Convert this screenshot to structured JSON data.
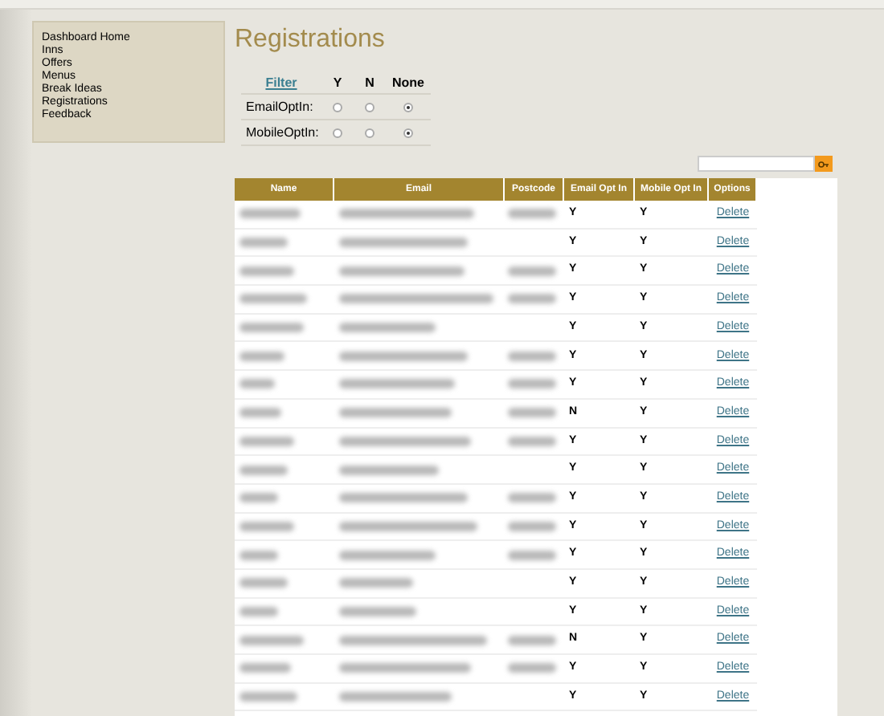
{
  "sidebar": {
    "items": [
      "Dashboard Home",
      "Inns",
      "Offers",
      "Menus",
      "Break Ideas",
      "Registrations",
      "Feedback"
    ]
  },
  "page_title": "Registrations",
  "filter": {
    "heading": "Filter",
    "columns": [
      "Y",
      "N",
      "None"
    ],
    "rows": [
      {
        "label": "EmailOptIn:",
        "options": [
          {
            "selected": false
          },
          {
            "selected": false
          },
          {
            "selected": true
          }
        ]
      },
      {
        "label": "MobileOptIn:",
        "options": [
          {
            "selected": false
          },
          {
            "selected": false
          },
          {
            "selected": true
          }
        ]
      }
    ]
  },
  "table": {
    "columns": [
      "Name",
      "Email",
      "Postcode",
      "Email Opt In",
      "Mobile Opt In",
      "Options"
    ],
    "rows": [
      {
        "postcode_blurred": true,
        "email_opt_in": "Y",
        "mobile_opt_in": "Y",
        "action": "Delete"
      },
      {
        "postcode_blurred": false,
        "email_opt_in": "Y",
        "mobile_opt_in": "Y",
        "action": "Delete"
      },
      {
        "postcode_blurred": true,
        "email_opt_in": "Y",
        "mobile_opt_in": "Y",
        "action": "Delete"
      },
      {
        "postcode_blurred": true,
        "email_opt_in": "Y",
        "mobile_opt_in": "Y",
        "action": "Delete"
      },
      {
        "postcode_blurred": false,
        "email_opt_in": "Y",
        "mobile_opt_in": "Y",
        "action": "Delete"
      },
      {
        "postcode_blurred": true,
        "email_opt_in": "Y",
        "mobile_opt_in": "Y",
        "action": "Delete"
      },
      {
        "postcode_blurred": true,
        "email_opt_in": "Y",
        "mobile_opt_in": "Y",
        "action": "Delete"
      },
      {
        "postcode_blurred": true,
        "email_opt_in": "N",
        "mobile_opt_in": "Y",
        "action": "Delete"
      },
      {
        "postcode_blurred": true,
        "email_opt_in": "Y",
        "mobile_opt_in": "Y",
        "action": "Delete"
      },
      {
        "postcode_blurred": false,
        "email_opt_in": "Y",
        "mobile_opt_in": "Y",
        "action": "Delete"
      },
      {
        "postcode_blurred": true,
        "email_opt_in": "Y",
        "mobile_opt_in": "Y",
        "action": "Delete"
      },
      {
        "postcode_blurred": true,
        "email_opt_in": "Y",
        "mobile_opt_in": "Y",
        "action": "Delete"
      },
      {
        "postcode_blurred": true,
        "email_opt_in": "Y",
        "mobile_opt_in": "Y",
        "action": "Delete"
      },
      {
        "postcode_blurred": false,
        "email_opt_in": "Y",
        "mobile_opt_in": "Y",
        "action": "Delete"
      },
      {
        "postcode_blurred": false,
        "email_opt_in": "Y",
        "mobile_opt_in": "Y",
        "action": "Delete"
      },
      {
        "postcode_blurred": true,
        "email_opt_in": "N",
        "mobile_opt_in": "Y",
        "action": "Delete"
      },
      {
        "postcode_blurred": true,
        "email_opt_in": "Y",
        "mobile_opt_in": "Y",
        "action": "Delete"
      },
      {
        "postcode_blurred": false,
        "email_opt_in": "Y",
        "mobile_opt_in": "Y",
        "action": "Delete"
      }
    ]
  }
}
